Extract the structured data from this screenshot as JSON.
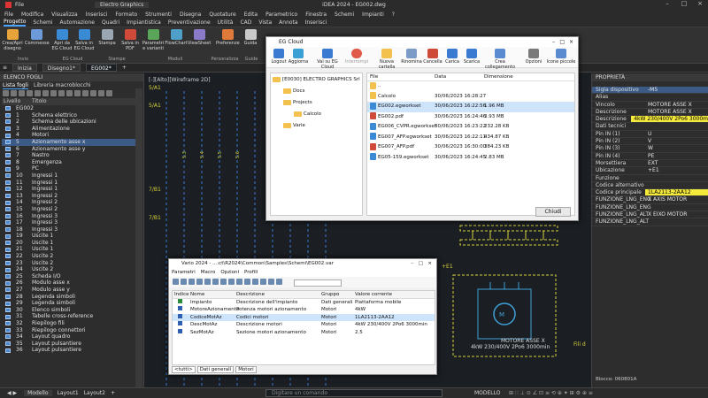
{
  "titlebar": {
    "app": "Electro Graphics",
    "center": "iDEA 2024 - EG002.dwg"
  },
  "menu": [
    "File",
    "Modifica",
    "Visualizza",
    "Inserisci",
    "Formato",
    "Strumenti",
    "Disegna",
    "Quotature",
    "Edita",
    "Parametrico",
    "Finestra",
    "Schemi",
    "Impianti",
    "?"
  ],
  "ribbon_tabs": [
    "Progetto",
    "Schemi",
    "Automazione",
    "Quadri",
    "Impiantistica",
    "Preventivazione",
    "Utilità",
    "CAD",
    "Vista",
    "Annota",
    "Inserisci"
  ],
  "ribbon_buttons": [
    "Crea/Apri disegno",
    "Commesse",
    "Apri da EG Cloud",
    "Salva in EG Cloud",
    "Stampa",
    "Salva in PDF",
    "Parametri e varianti",
    "FlowChart",
    "ViewSheet",
    "Preferenze",
    "Guida",
    "Guida"
  ],
  "ribbon_groups": [
    "Invio",
    "EG Cloud",
    "Stampe",
    "Moduli",
    "Personalizza",
    "Guide"
  ],
  "doc_tabs": [
    "Inizia",
    "Disegno1*",
    "EG002*"
  ],
  "left_panel": {
    "title": "ELENCO FOGLI",
    "tab1": "Lista fogli",
    "tab2": "Libreria macroblocchi",
    "col_level": "Livello",
    "col_title": "Titolo"
  },
  "sheets": [
    {
      "num": "EG002",
      "title": ""
    },
    {
      "num": "1",
      "title": "Schema elettrico"
    },
    {
      "num": "2",
      "title": "Schema delle ubicazioni"
    },
    {
      "num": "3",
      "title": "Alimentazione"
    },
    {
      "num": "4",
      "title": "Motori"
    },
    {
      "num": "5",
      "title": "Azionamento asse x"
    },
    {
      "num": "6",
      "title": "Azionamento asse y"
    },
    {
      "num": "7",
      "title": "Nastro"
    },
    {
      "num": "8",
      "title": "Emergenza"
    },
    {
      "num": "9",
      "title": "PC"
    },
    {
      "num": "10",
      "title": "Ingressi 1"
    },
    {
      "num": "11",
      "title": "Ingressi 1"
    },
    {
      "num": "12",
      "title": "Ingressi 1"
    },
    {
      "num": "13",
      "title": "Ingressi 2"
    },
    {
      "num": "14",
      "title": "Ingressi 2"
    },
    {
      "num": "15",
      "title": "Ingressi 2"
    },
    {
      "num": "16",
      "title": "Ingressi 3"
    },
    {
      "num": "17",
      "title": "Ingressi 3"
    },
    {
      "num": "18",
      "title": "Ingressi 3"
    },
    {
      "num": "19",
      "title": "Uscite 1"
    },
    {
      "num": "20",
      "title": "Uscite 1"
    },
    {
      "num": "21",
      "title": "Uscite 1"
    },
    {
      "num": "22",
      "title": "Uscite 2"
    },
    {
      "num": "23",
      "title": "Uscite 2"
    },
    {
      "num": "24",
      "title": "Uscite 2"
    },
    {
      "num": "25",
      "title": "Scheda I/O"
    },
    {
      "num": "26",
      "title": "Modulo asse x"
    },
    {
      "num": "27",
      "title": "Modulo asse y"
    },
    {
      "num": "28",
      "title": "Legenda simboli"
    },
    {
      "num": "29",
      "title": "Legenda simboli"
    },
    {
      "num": "30",
      "title": "Elenco simboli"
    },
    {
      "num": "31",
      "title": "Tabelle cross-reference"
    },
    {
      "num": "32",
      "title": "Riepilogo fili"
    },
    {
      "num": "33",
      "title": "Riepilogo connettori"
    },
    {
      "num": "34",
      "title": "Layout quadro"
    },
    {
      "num": "35",
      "title": "Layout pulsantiere"
    },
    {
      "num": "36",
      "title": "Layout pulsantiere"
    }
  ],
  "drawing": {
    "viewport_label": "[-][Alto][Wireframe 2D]",
    "labels": [
      "5/A1",
      "7/B1",
      "7/B1",
      "+E1",
      "1",
      "5.3",
      "5.4",
      "5.5",
      "5.6",
      "5.2",
      "1.1",
      "2",
      "3",
      "4",
      "5",
      "6"
    ],
    "motor_label": "MOTORE ASSE X",
    "motor_spec": "4kW 230/400V 2Po6 3000min",
    "tail": "Fili d"
  },
  "cloud": {
    "title": "EG Cloud",
    "tools": [
      "Logout",
      "Aggiorna",
      "Vai su EG Cloud",
      "Interrompi",
      "Nuova cartella",
      "Rinomina",
      "Cancella",
      "Carica",
      "Scarica",
      "Crea collegamento",
      "Opzioni",
      "Icone piccole"
    ],
    "tree": [
      "[E0030] ELECTRO GRAPHICS Srl",
      "Docs",
      "Projects",
      "Calcolo",
      "Varie"
    ],
    "col_file": "File",
    "col_date": "Data",
    "col_size": "Dimensione",
    "files": [
      {
        "name": "..",
        "date": "",
        "size": ""
      },
      {
        "name": "Calcolo",
        "date": "30/06/2023 16:28:27",
        "size": ""
      },
      {
        "name": "EG002.egworkset",
        "date": "30/06/2023 16:22:56",
        "size": "1.96 MB"
      },
      {
        "name": "EG002.pdf",
        "date": "30/06/2023 16:24:46",
        "size": "3.93 MB"
      },
      {
        "name": "EG006_CVPR.egworkset",
        "date": "30/06/2023 16:23:22",
        "size": "232.28 KB"
      },
      {
        "name": "EG007_AFP.egworkset",
        "date": "30/06/2023 16:22:11",
        "size": "434.87 KB"
      },
      {
        "name": "EG007_AFP.pdf",
        "date": "30/06/2023 16:30:00",
        "size": "384.23 KB"
      },
      {
        "name": "EG05-159.egworkset",
        "date": "30/06/2023 16:24:45",
        "size": "2.83 MB"
      }
    ],
    "close": "Chiudi"
  },
  "vario": {
    "title": "Vario 2024 - ...:ct\\R2024\\Common\\Samples\\Schemi\\EG002.var",
    "menu": [
      "Parametri",
      "Macro",
      "Opzioni",
      "Profili"
    ],
    "headers": [
      "Indice",
      "Nome",
      "Descrizione",
      "Gruppo",
      "Valore corrente"
    ],
    "rows": [
      {
        "i": "1",
        "name": "Impianto",
        "desc": "Descrizione dell'impianto",
        "group": "Dati generali",
        "value": "Piattaforma mobile"
      },
      {
        "i": "2",
        "name": "MotoreAzionamento",
        "desc": "Potenza motori azionamento",
        "group": "Motori",
        "value": "4kW"
      },
      {
        "i": "3",
        "name": "CodiceMotAz",
        "desc": "Codici motori",
        "group": "Motori",
        "value": "1LA2113-2AA12"
      },
      {
        "i": "4",
        "name": "DescMotAz",
        "desc": "Descrizione motori",
        "group": "Motori",
        "value": "4kW 230/400V 2Po6 3000min"
      },
      {
        "i": "5",
        "name": "SezMotAz",
        "desc": "Sezione motori azionamento",
        "group": "Motori",
        "value": "2.5"
      }
    ],
    "tabs": [
      "<tutti>",
      "Dati generali",
      "Motori"
    ]
  },
  "props": {
    "title": "PROPRIETÀ",
    "rows": [
      {
        "k": "Sigla dispositivo",
        "v": "-M5"
      },
      {
        "k": "Alias",
        "v": ""
      },
      {
        "k": "Vincolo",
        "v": "MOTORE ASSE X"
      },
      {
        "k": "Descrizione",
        "v": "MOTORE ASSE X"
      },
      {
        "k": "Descrizione",
        "v": "4kW 230/400V 2Po6 3000m"
      },
      {
        "k": "Dati tecnici",
        "v": ""
      },
      {
        "k": "Pin IN (1)",
        "v": "U"
      },
      {
        "k": "Pin IN (2)",
        "v": "V"
      },
      {
        "k": "Pin IN (3)",
        "v": "W"
      },
      {
        "k": "Pin IN (4)",
        "v": "PE"
      },
      {
        "k": "Morsettiera",
        "v": "EXT"
      },
      {
        "k": "Ubicazione",
        "v": "+E1"
      },
      {
        "k": "Funzione",
        "v": ""
      },
      {
        "k": "Codice alternativo",
        "v": ""
      },
      {
        "k": "Codice principale",
        "v": "1LA2113-2AA12"
      },
      {
        "k": "FUNZIONE_LNG_ENG",
        "v": "X AXIS MOTOR"
      },
      {
        "k": "FUNZIONE_LNG_ENG",
        "v": ""
      },
      {
        "k": "FUNZIONE_LNG_ALT",
        "v": "X EIXO MOTOR"
      },
      {
        "k": "FUNZIONE_LNG_ALT",
        "v": ""
      }
    ],
    "footer": "Blocco: 060801A"
  },
  "status": {
    "tabs": [
      "Modello",
      "Layout1",
      "Layout2"
    ],
    "command": "Digitare un comando",
    "mode": "MODELLO"
  },
  "colors": {
    "accent": "#4aa3ff",
    "highlight": "#f4ea3b",
    "selection": "#3b5b86"
  }
}
